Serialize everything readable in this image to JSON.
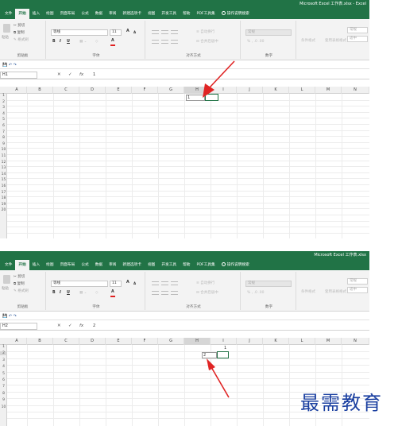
{
  "window": {
    "title": "Microsoft Excel 工作表.xlsx - Excel",
    "title_short": "Microsoft Excel 工作表.xlsx"
  },
  "tabs": [
    "文件",
    "开始",
    "插入",
    "绘图",
    "页面布局",
    "公式",
    "数据",
    "审阅",
    "新建选项卡",
    "视图",
    "开发工具",
    "帮助",
    "PDF工具集"
  ],
  "tell_me": "操作说明搜索",
  "clipboard": {
    "paste": "粘贴",
    "cut": "剪切",
    "copy": "复制",
    "format_painter": "格式刷",
    "group": "剪贴板"
  },
  "font": {
    "name": "等线",
    "size": "11",
    "bold": "B",
    "italic": "I",
    "underline": "U",
    "grow": "A",
    "shrink": "A",
    "color": "A",
    "group": "字体"
  },
  "alignment": {
    "wrap": "自动换行",
    "merge": "合并后居中",
    "group": "对齐方式"
  },
  "number": {
    "format": "常规",
    "group": "数字"
  },
  "styles": {
    "conditional": "条件格式",
    "table": "套用表格格式",
    "cell_style_1": "常规",
    "cell_style_2": "适中"
  },
  "columns": [
    "A",
    "B",
    "C",
    "D",
    "E",
    "F",
    "G",
    "H",
    "I",
    "J",
    "K",
    "L",
    "M",
    "N"
  ],
  "rows": [
    "1",
    "2",
    "3",
    "4",
    "5",
    "6",
    "7",
    "8",
    "9",
    "10",
    "11",
    "12",
    "13",
    "14",
    "15",
    "16",
    "17",
    "18",
    "19",
    "20"
  ],
  "rows2": [
    "1",
    "2",
    "3",
    "4",
    "5",
    "6",
    "7",
    "8",
    "9",
    "10"
  ],
  "shot1": {
    "name_box": "H1",
    "formula": "1",
    "cell_g1": "1"
  },
  "shot2": {
    "name_box": "H2",
    "formula": "2",
    "cell_g2": "2",
    "cell_h1": "1"
  },
  "watermark": "最需教育",
  "colors": {
    "excel_green": "#217346",
    "arrow_red": "#e02424",
    "logo_blue": "#1a3fa0"
  }
}
